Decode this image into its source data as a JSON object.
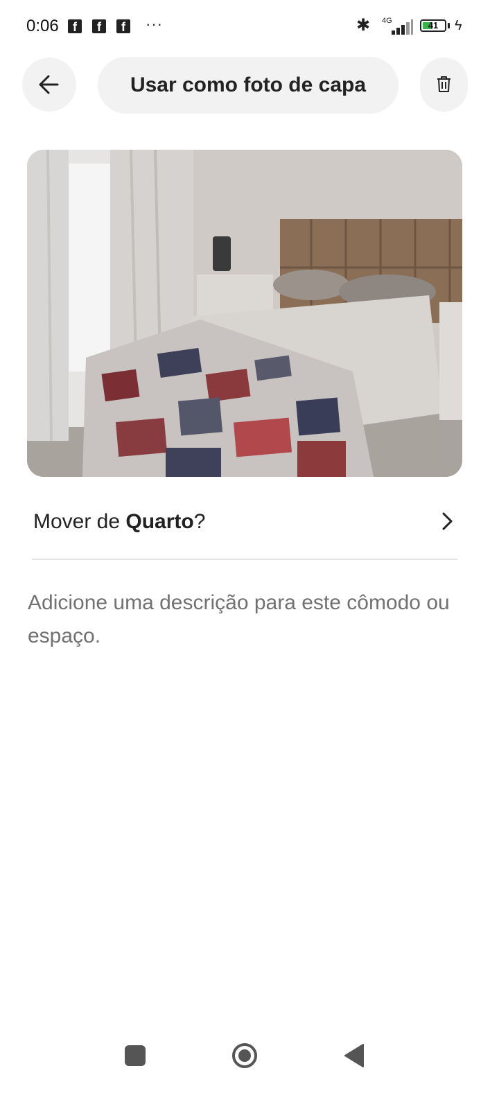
{
  "status_bar": {
    "time": "0:06",
    "notification_icons": [
      "facebook-icon",
      "facebook-icon",
      "facebook-icon"
    ],
    "more_indicator": "···",
    "network_label": "4G",
    "battery_level": "41"
  },
  "header": {
    "cover_button_label": "Usar como foto de capa"
  },
  "move_row": {
    "prefix": "Mover de ",
    "room_name": "Quarto",
    "suffix": "?"
  },
  "description_placeholder": "Adicione uma descrição para este cômodo ou espaço.",
  "colors": {
    "button_bg": "#f2f2f2",
    "text_primary": "#222222",
    "text_secondary": "#717171",
    "divider": "#e4e4e4",
    "battery_fill": "#38b24a"
  }
}
